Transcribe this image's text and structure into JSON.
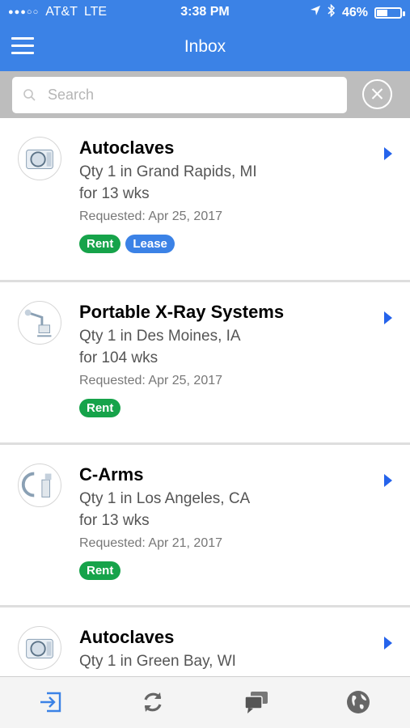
{
  "status": {
    "carrier": "AT&T",
    "network": "LTE",
    "time": "3:38 PM",
    "battery": "46%",
    "battery_level": 0.46
  },
  "header": {
    "title": "Inbox"
  },
  "search": {
    "placeholder": "Search",
    "value": ""
  },
  "requests": [
    {
      "title": "Autoclaves",
      "line1": "Qty 1 in Grand Rapids, MI",
      "line2": "for 13 wks",
      "date": "Requested: Apr 25, 2017",
      "badges": [
        "Rent",
        "Lease"
      ],
      "thumb_icon": "autoclave-thumbnail"
    },
    {
      "title": "Portable X-Ray Systems",
      "line1": "Qty 1 in Des Moines, IA",
      "line2": "for 104 wks",
      "date": "Requested: Apr 25, 2017",
      "badges": [
        "Rent"
      ],
      "thumb_icon": "xray-system-thumbnail"
    },
    {
      "title": "C-Arms",
      "line1": "Qty 1 in Los Angeles, CA",
      "line2": "for 13 wks",
      "date": "Requested: Apr 21, 2017",
      "badges": [
        "Rent"
      ],
      "thumb_icon": "c-arm-thumbnail"
    },
    {
      "title": "Autoclaves",
      "line1": "Qty 1 in Green Bay, WI",
      "line2": "",
      "date": "",
      "badges": [],
      "thumb_icon": "autoclave-thumbnail"
    }
  ],
  "tabs": [
    {
      "icon": "inbox-icon",
      "active": true
    },
    {
      "icon": "refresh-icon",
      "active": false
    },
    {
      "icon": "chat-icon",
      "active": false
    },
    {
      "icon": "globe-icon",
      "active": false
    }
  ],
  "colors": {
    "brand_blue": "#3b82e6",
    "rent_green": "#16a34a",
    "lease_blue": "#3b82e6",
    "chevron_blue": "#2563eb"
  }
}
